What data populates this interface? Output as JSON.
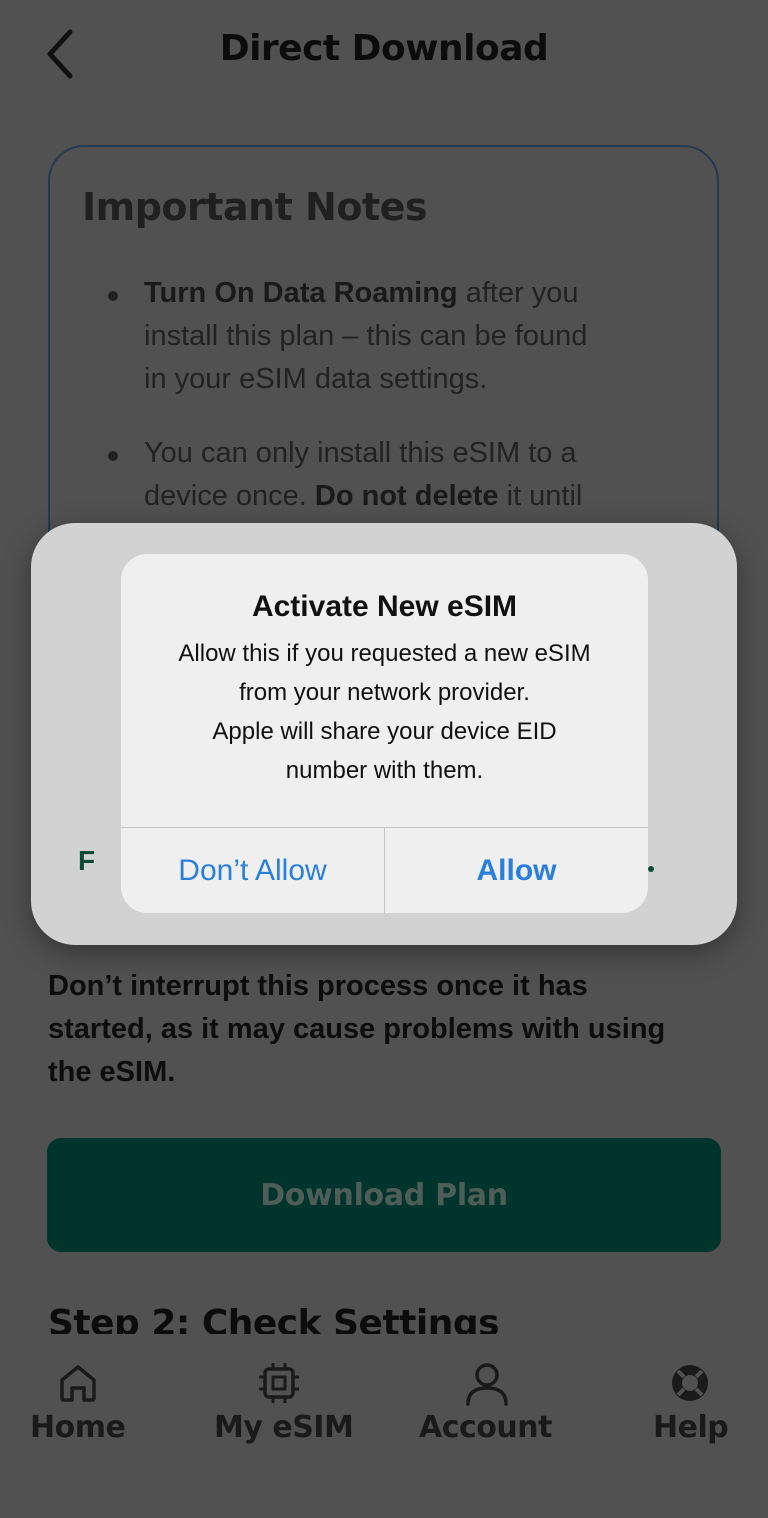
{
  "header": {
    "title": "Direct Download"
  },
  "notes": {
    "title": "Important Notes",
    "items": [
      {
        "bold": "Turn On Data Roaming",
        "line1_rest": " after you",
        "line2": "install this plan – this can be found",
        "line3": "in your eSIM data settings."
      },
      {
        "line1": "You can only install this eSIM to a",
        "line2_start": "device once. ",
        "bold": "Do not delete",
        "line2_rest": " it until"
      }
    ]
  },
  "sheet": {
    "edge_left_text": "F",
    "edge_right_text": "."
  },
  "alert": {
    "title": "Activate New eSIM",
    "message_lines": [
      "Allow this if you requested a new eSIM",
      "from your network provider.",
      "Apple will share your device EID",
      "number with them."
    ],
    "deny_label": "Don’t Allow",
    "allow_label": "Allow"
  },
  "warning": {
    "lines": [
      "Don’t interrupt this process once it has",
      "started, as it may cause problems with using",
      "the eSIM."
    ]
  },
  "download_button": {
    "label": "Download Plan"
  },
  "step2": {
    "heading": "Step 2: Check Settings"
  },
  "bottom_nav": {
    "items": [
      {
        "label": "Home",
        "icon": "home-icon"
      },
      {
        "label": "My eSIM",
        "icon": "chip-icon"
      },
      {
        "label": "Account",
        "icon": "user-icon"
      },
      {
        "label": "Help",
        "icon": "lifebuoy-icon"
      }
    ]
  },
  "colors": {
    "overlay_background": "#515151",
    "button_primary": "#00342c",
    "ios_blue": "#2a7fdc",
    "card_border": "#253a52"
  }
}
